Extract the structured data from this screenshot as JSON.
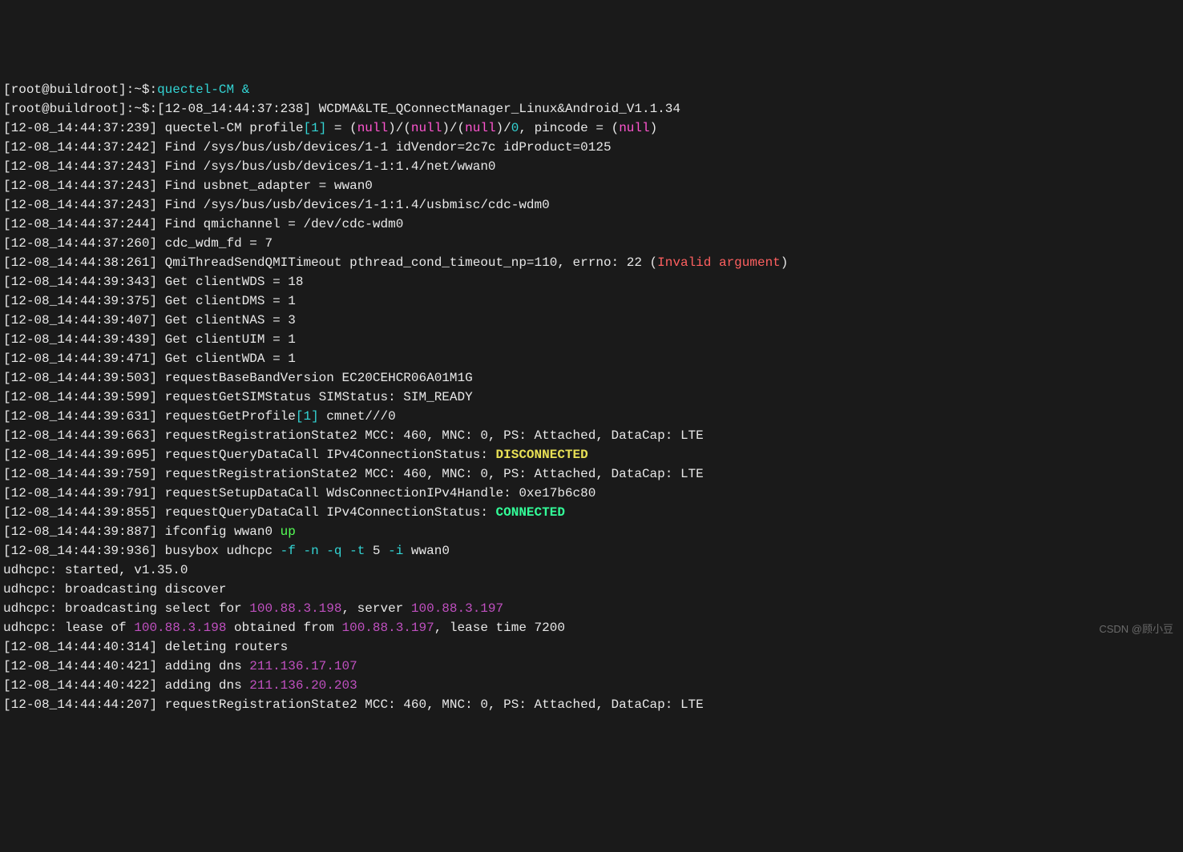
{
  "prompt1": {
    "user": "root",
    "host": "buildroot",
    "cmd": "quectel-CM",
    "amp": "&"
  },
  "prompt2": {
    "user": "root",
    "host": "buildroot",
    "ts": "12-08_14:44:37:238",
    "banner": " WCDMA&LTE_QConnectManager_Linux&Android_V1.1.34"
  },
  "l3": {
    "ts": "12-08_14:44:37:239",
    "pre": " quectel-CM profile",
    "br": "[1]",
    "eq": " = (",
    "n1": "null",
    "s1": ")/(",
    "n2": "null",
    "s2": ")/(",
    "n3": "null",
    "s3": ")/",
    "z": "0",
    "pin": ", pincode = (",
    "n4": "null",
    "cl": ")"
  },
  "l4": {
    "ts": "12-08_14:44:37:242",
    "txt": " Find /sys/bus/usb/devices/1-1 idVendor=2c7c idProduct=0125"
  },
  "l5": {
    "ts": "12-08_14:44:37:243",
    "txt": " Find /sys/bus/usb/devices/1-1:1.4/net/wwan0"
  },
  "l6": {
    "ts": "12-08_14:44:37:243",
    "txt": " Find usbnet_adapter = wwan0"
  },
  "l7": {
    "ts": "12-08_14:44:37:243",
    "txt": " Find /sys/bus/usb/devices/1-1:1.4/usbmisc/cdc-wdm0"
  },
  "l8": {
    "ts": "12-08_14:44:37:244",
    "txt": " Find qmichannel = /dev/cdc-wdm0"
  },
  "l9": {
    "ts": "12-08_14:44:37:260",
    "txt": " cdc_wdm_fd = 7"
  },
  "l10": {
    "ts": "12-08_14:44:38:261",
    "pre": " QmiThreadSendQMITimeout pthread_cond_timeout_np=110, errno: 22 (",
    "err": "Invalid argument",
    "post": ")"
  },
  "l11": {
    "ts": "12-08_14:44:39:343",
    "txt": " Get clientWDS = 18"
  },
  "l12": {
    "ts": "12-08_14:44:39:375",
    "txt": " Get clientDMS = 1"
  },
  "l13": {
    "ts": "12-08_14:44:39:407",
    "txt": " Get clientNAS = 3"
  },
  "l14": {
    "ts": "12-08_14:44:39:439",
    "txt": " Get clientUIM = 1"
  },
  "l15": {
    "ts": "12-08_14:44:39:471",
    "txt": " Get clientWDA = 1"
  },
  "l16": {
    "ts": "12-08_14:44:39:503",
    "txt": " requestBaseBandVersion EC20CEHCR06A01M1G"
  },
  "l17": {
    "ts": "12-08_14:44:39:599",
    "txt": " requestGetSIMStatus SIMStatus: SIM_READY"
  },
  "l18": {
    "ts": "12-08_14:44:39:631",
    "pre": " requestGetProfile",
    "br": "[1]",
    "post": " cmnet///0"
  },
  "l19": {
    "ts": "12-08_14:44:39:663",
    "txt": " requestRegistrationState2 MCC: 460, MNC: 0, PS: Attached, DataCap: LTE"
  },
  "l20": {
    "ts": "12-08_14:44:39:695",
    "pre": " requestQueryDataCall IPv4ConnectionStatus: ",
    "stat": "DISCONNECTED"
  },
  "l21": {
    "ts": "12-08_14:44:39:759",
    "txt": " requestRegistrationState2 MCC: 460, MNC: 0, PS: Attached, DataCap: LTE"
  },
  "l22": {
    "ts": "12-08_14:44:39:791",
    "txt": " requestSetupDataCall WdsConnectionIPv4Handle: 0xe17b6c80"
  },
  "l23": {
    "ts": "12-08_14:44:39:855",
    "pre": " requestQueryDataCall IPv4ConnectionStatus: ",
    "stat": "CONNECTED"
  },
  "l24": {
    "ts": "12-08_14:44:39:887",
    "pre": " ifconfig wwan0 ",
    "up": "up"
  },
  "l25": {
    "ts": "12-08_14:44:39:936",
    "pre": " busybox udhcpc ",
    "flags": "-f -n -q -t",
    "five": " 5 ",
    "iflag": "-i",
    "post": " wwan0"
  },
  "l26": {
    "txt": "udhcpc: started, v1.35.0"
  },
  "l27": {
    "txt": "udhcpc: broadcasting discover"
  },
  "l28": {
    "pre": "udhcpc: broadcasting select for ",
    "ip1": "100.88.3.198",
    "mid": ", server ",
    "ip2": "100.88.3.197"
  },
  "l29": {
    "pre": "udhcpc: lease of ",
    "ip1": "100.88.3.198",
    "mid": " obtained from ",
    "ip2": "100.88.3.197",
    "post": ", lease time 7200"
  },
  "l30": {
    "ts": "12-08_14:44:40:314",
    "txt": " deleting routers"
  },
  "l31": {
    "ts": "12-08_14:44:40:421",
    "pre": " adding dns ",
    "ip": "211.136.17.107"
  },
  "l32": {
    "ts": "12-08_14:44:40:422",
    "pre": " adding dns ",
    "ip": "211.136.20.203"
  },
  "l33": {
    "ts": "12-08_14:44:44:207",
    "txt": " requestRegistrationState2 MCC: 460, MNC: 0, PS: Attached, DataCap: LTE"
  },
  "watermark": "CSDN @顾小豆"
}
